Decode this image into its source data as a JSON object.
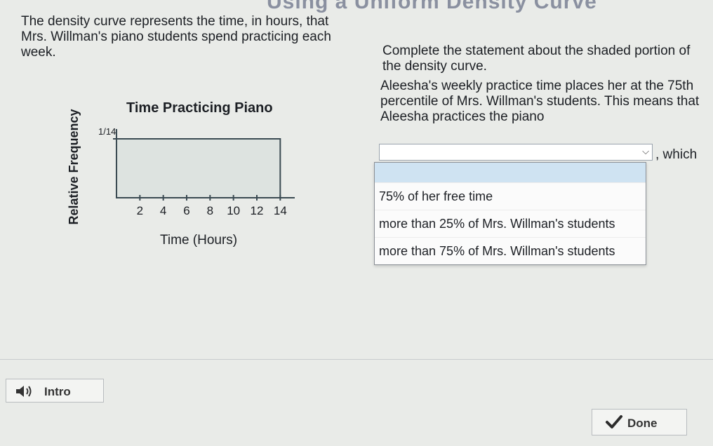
{
  "page": {
    "title": "Using a Uniform Density Curve"
  },
  "left": {
    "prompt": "The density curve represents the time, in hours, that Mrs. Willman's piano students spend practicing each week."
  },
  "right": {
    "instruction": "Complete the statement about the shaded portion of the density curve.",
    "statement_part1": "Aleesha's weekly practice time places her at the 75th percentile of Mrs. Willman's students. This means that Aleesha practices the piano",
    "dropdown_value": "",
    "which_text": ", which",
    "options": [
      "75% of her free time",
      "more than 25% of Mrs. Willman's students",
      "more than 75% of Mrs. Willman's students"
    ]
  },
  "chart_data": {
    "type": "area",
    "title": "Time Practicing Piano",
    "xlabel": "Time (Hours)",
    "ylabel": "Relative Frequency",
    "x": [
      0,
      14
    ],
    "y": [
      0.0714,
      0.0714
    ],
    "y_tick_label": "1/14",
    "x_ticks": [
      "2",
      "4",
      "6",
      "8",
      "10",
      "12",
      "14"
    ],
    "xlim": [
      0,
      15
    ],
    "ylim": [
      0,
      0.0714
    ]
  },
  "buttons": {
    "intro": "Intro",
    "done": "Done"
  },
  "icons": {
    "speaker": "speaker-icon",
    "check": "checkmark-icon",
    "chevron": "chevron-down-icon"
  }
}
